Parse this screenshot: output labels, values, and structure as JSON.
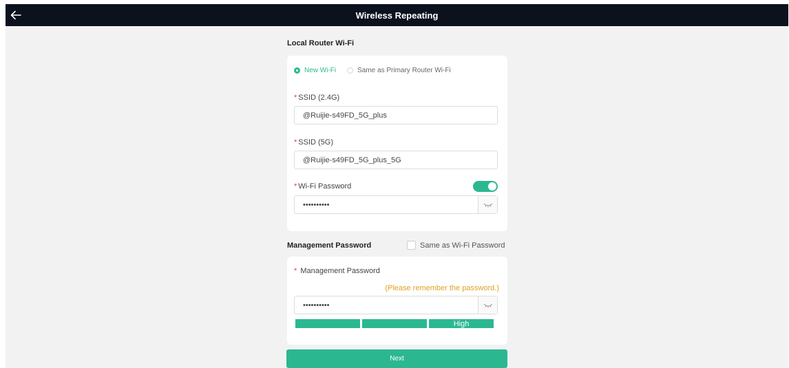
{
  "header": {
    "title": "Wireless Repeating",
    "back_icon": "arrow-left-icon"
  },
  "local_wifi": {
    "section_title": "Local Router Wi-Fi",
    "options": [
      {
        "label": "New Wi-Fi",
        "checked": true
      },
      {
        "label": "Same as Primary Router Wi-Fi",
        "checked": false
      }
    ],
    "ssid_24": {
      "label": "SSID (2.4G)",
      "value": "@Ruijie-s49FD_5G_plus"
    },
    "ssid_5": {
      "label": "SSID (5G)",
      "value": "@Ruijie-s49FD_5G_plus_5G"
    },
    "wifi_password": {
      "label": "Wi-Fi Password",
      "value": "••••••••••",
      "toggle_on": true
    }
  },
  "management": {
    "section_title": "Management Password",
    "same_as_label": "Same as Wi-Fi Password",
    "same_as_checked": false,
    "password_label": "Management Password",
    "hint": "(Please remember the password.)",
    "value": "••••••••••",
    "strength": [
      "",
      "",
      "High"
    ]
  },
  "actions": {
    "next_label": "Next"
  },
  "colors": {
    "accent": "#2bb891",
    "topbar": "#0b111d",
    "required": "#e0403a",
    "hint": "#e0a020"
  }
}
